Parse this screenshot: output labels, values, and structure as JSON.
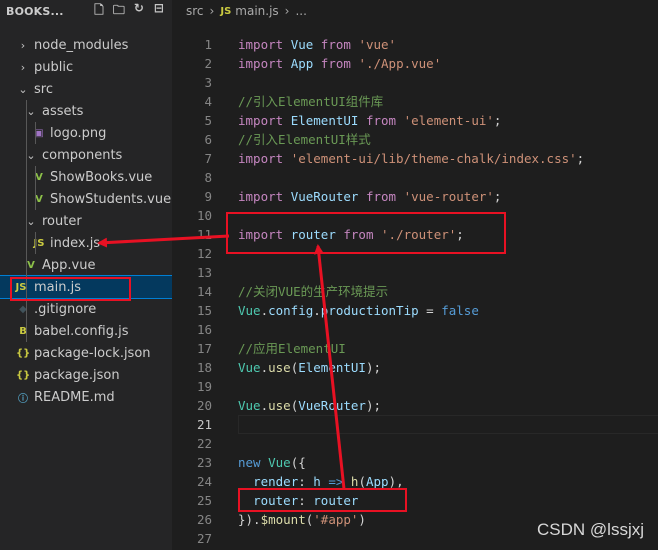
{
  "explorer": {
    "title": "BOOKS...",
    "tools": [
      {
        "icon": "new-file-icon",
        "glyph": "🗋"
      },
      {
        "icon": "new-folder-icon",
        "glyph": "🗀"
      },
      {
        "icon": "refresh-icon",
        "glyph": "↻"
      },
      {
        "icon": "collapse-all-icon",
        "glyph": "⊟"
      }
    ],
    "items": [
      {
        "label": "node_modules",
        "chev": "›",
        "icon": "",
        "icon_color": "#c5c5c5"
      },
      {
        "label": "public",
        "chev": "›",
        "icon": "",
        "icon_color": "#c5c5c5"
      },
      {
        "label": "src",
        "chev": "⌄",
        "icon": "",
        "icon_color": "#c5c5c5"
      },
      {
        "label": "assets",
        "chev": "⌄",
        "icon": "",
        "icon_color": "#c5c5c5"
      },
      {
        "label": "logo.png",
        "chev": "",
        "icon": "▣",
        "icon_color": "#a074c4"
      },
      {
        "label": "components",
        "chev": "⌄",
        "icon": "",
        "icon_color": "#c5c5c5"
      },
      {
        "label": "ShowBooks.vue",
        "chev": "",
        "icon": "V",
        "icon_color": "#8dc149"
      },
      {
        "label": "ShowStudents.vue",
        "chev": "",
        "icon": "V",
        "icon_color": "#8dc149"
      },
      {
        "label": "router",
        "chev": "⌄",
        "icon": "",
        "icon_color": "#c5c5c5"
      },
      {
        "label": "index.js",
        "chev": "",
        "icon": "JS",
        "icon_color": "#cbcb41"
      },
      {
        "label": "App.vue",
        "chev": "",
        "icon": "V",
        "icon_color": "#8dc149"
      },
      {
        "label": "main.js",
        "chev": "",
        "icon": "JS",
        "icon_color": "#cbcb41"
      },
      {
        "label": ".gitignore",
        "chev": "",
        "icon": "◆",
        "icon_color": "#41535b"
      },
      {
        "label": "babel.config.js",
        "chev": "",
        "icon": "B",
        "icon_color": "#cbcb41"
      },
      {
        "label": "package-lock.json",
        "chev": "",
        "icon": "{}",
        "icon_color": "#cbcb41"
      },
      {
        "label": "package.json",
        "chev": "",
        "icon": "{}",
        "icon_color": "#cbcb41"
      },
      {
        "label": "README.md",
        "chev": "",
        "icon": "ⓘ",
        "icon_color": "#519aba"
      }
    ],
    "selected_label": "main.js"
  },
  "breadcrumb": {
    "folder": "src",
    "file_icon": "JS",
    "file": "main.js",
    "more": "..."
  },
  "editor": {
    "active_line": 21,
    "lines": [
      [
        [
          "kw",
          "import "
        ],
        [
          "id",
          "Vue "
        ],
        [
          "kw",
          "from "
        ],
        [
          "st",
          "'vue'"
        ]
      ],
      [
        [
          "kw",
          "import "
        ],
        [
          "id",
          "App "
        ],
        [
          "kw",
          "from "
        ],
        [
          "st",
          "'./App.vue'"
        ]
      ],
      [],
      [
        [
          "cm",
          "//引入ElementUI组件库"
        ]
      ],
      [
        [
          "kw",
          "import "
        ],
        [
          "id",
          "ElementUI "
        ],
        [
          "kw",
          "from "
        ],
        [
          "st",
          "'element-ui'"
        ],
        [
          "pu",
          ";"
        ]
      ],
      [
        [
          "cm",
          "//引入ElementUI样式"
        ]
      ],
      [
        [
          "kw",
          "import "
        ],
        [
          "st",
          "'element-ui/lib/theme-chalk/index.css'"
        ],
        [
          "pu",
          ";"
        ]
      ],
      [],
      [
        [
          "kw",
          "import "
        ],
        [
          "id",
          "VueRouter "
        ],
        [
          "kw",
          "from "
        ],
        [
          "st",
          "'vue-router'"
        ],
        [
          "pu",
          ";"
        ]
      ],
      [],
      [
        [
          "kw",
          "import "
        ],
        [
          "id",
          "router "
        ],
        [
          "kw",
          "from "
        ],
        [
          "st",
          "'./router'"
        ],
        [
          "pu",
          ";"
        ]
      ],
      [],
      [],
      [
        [
          "cm",
          "//关闭VUE的生产环境提示"
        ]
      ],
      [
        [
          "cls",
          "Vue"
        ],
        [
          "pu",
          "."
        ],
        [
          "id",
          "config"
        ],
        [
          "pu",
          "."
        ],
        [
          "id",
          "productionTip"
        ],
        [
          "pu",
          " = "
        ],
        [
          "kb",
          "false"
        ]
      ],
      [],
      [
        [
          "cm",
          "//应用ElementUI"
        ]
      ],
      [
        [
          "cls",
          "Vue"
        ],
        [
          "pu",
          "."
        ],
        [
          "fn",
          "use"
        ],
        [
          "pu",
          "("
        ],
        [
          "id",
          "ElementUI"
        ],
        [
          "pu",
          ");"
        ]
      ],
      [],
      [
        [
          "cls",
          "Vue"
        ],
        [
          "pu",
          "."
        ],
        [
          "fn",
          "use"
        ],
        [
          "pu",
          "("
        ],
        [
          "id",
          "VueRouter"
        ],
        [
          "pu",
          ");"
        ]
      ],
      [],
      [],
      [
        [
          "kb",
          "new "
        ],
        [
          "cls",
          "Vue"
        ],
        [
          "pu",
          "({"
        ]
      ],
      [
        [
          "pu",
          "  "
        ],
        [
          "id",
          "render"
        ],
        [
          "pu",
          ": "
        ],
        [
          "id",
          "h"
        ],
        [
          "kb",
          " => "
        ],
        [
          "fn",
          "h"
        ],
        [
          "pu",
          "("
        ],
        [
          "id",
          "App"
        ],
        [
          "pu",
          "),"
        ]
      ],
      [
        [
          "pu",
          "  "
        ],
        [
          "id",
          "router"
        ],
        [
          "pu",
          ": "
        ],
        [
          "id",
          "router"
        ]
      ],
      [
        [
          "pu",
          "})."
        ],
        [
          "fn",
          "$mount"
        ],
        [
          "pu",
          "("
        ],
        [
          "st",
          "'#app'"
        ],
        [
          "pu",
          ")"
        ]
      ],
      []
    ]
  },
  "watermark": "CSDN @lssjxj",
  "annotation_color": "#e81123"
}
